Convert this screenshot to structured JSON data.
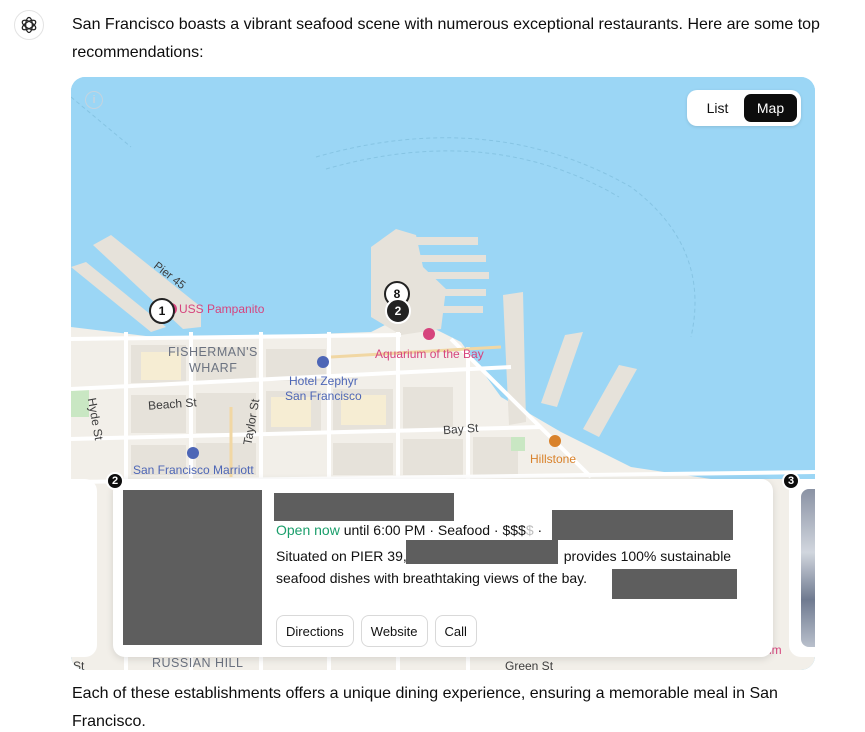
{
  "message": {
    "intro": "San Francisco boasts a vibrant seafood scene with numerous exceptional restaurants. Here are some top recommendations:",
    "outro": "Each of these establishments offers a unique dining experience, ensuring a memorable meal in San Francisco."
  },
  "map": {
    "info_icon_glyph": "i",
    "toggle": {
      "list_label": "List",
      "map_label": "Map",
      "selected": "Map"
    },
    "labels": {
      "pier45": "Pier 45",
      "uss_pampanito": "USS Pampanito",
      "fishermans_wharf_line1": "FISHERMAN'S",
      "fishermans_wharf_line2": "WHARF",
      "aquarium": "Aquarium of the Bay",
      "hotel_zephyr_line1": "Hotel Zephyr",
      "hotel_zephyr_line2": "San Francisco",
      "beach_st": "Beach St",
      "taylor_st": "Taylor St",
      "hyde_st": "Hyde St",
      "bay_st": "Bay St",
      "hillstone": "Hillstone",
      "marriott": "San Francisco Marriott",
      "russian_hill": "RUSSIAN HILL",
      "bottom_street_partial": "Green St",
      "left_edge_partial": "St",
      "right_edge_partial": "um"
    },
    "pins": [
      {
        "number": "1",
        "style": "white"
      },
      {
        "number": "8",
        "style": "white"
      },
      {
        "number": "2",
        "style": "black"
      }
    ],
    "colors": {
      "water": "#9bd6f5",
      "land": "#f2efe9",
      "block": "#e6e2da",
      "park": "#c9e7c3",
      "pin_dark": "#222222",
      "open_green": "#1a9e6b",
      "poi_pink": "#d6447d"
    }
  },
  "card": {
    "badge_number": "2",
    "open_status": "Open now",
    "hours": " until 6:00 PM · Seafood · $$$",
    "price_muted": "$",
    "separator": " ·",
    "desc_part1": "Situated on PIER 39,",
    "desc_part2": "provides 100% sustainable",
    "desc_line2": "seafood dishes with breathtaking views of the bay.",
    "buttons": {
      "directions": "Directions",
      "website": "Website",
      "call": "Call"
    }
  },
  "side_cards": {
    "right_badge_number": "3"
  }
}
